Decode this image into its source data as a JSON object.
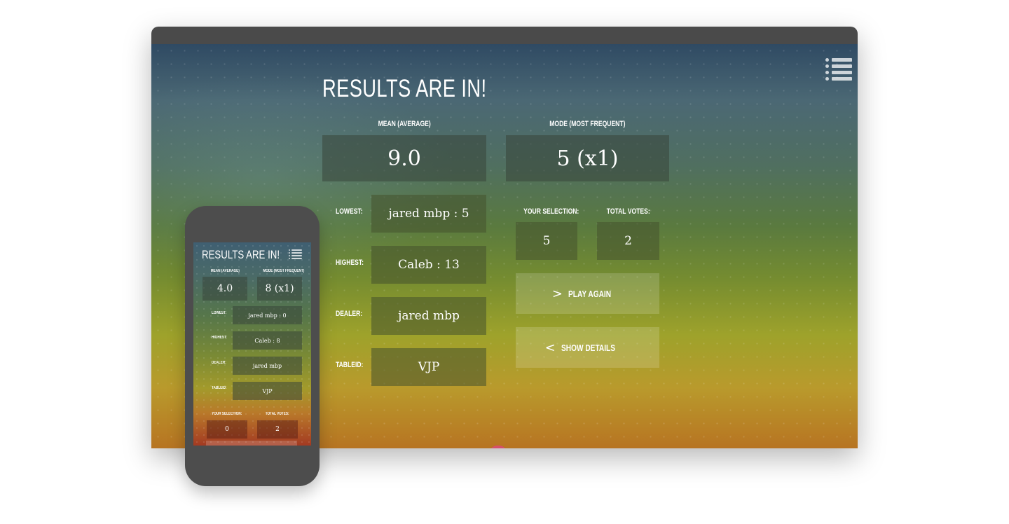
{
  "desktop": {
    "title": "RESULTS ARE IN!",
    "mean_label": "MEAN (AVERAGE)",
    "mean_value": "9.0",
    "mode_label": "MODE (MOST FREQUENT)",
    "mode_value": "5 (x1)",
    "lowest_label": "LOWEST:",
    "lowest_value": "jared mbp : 5",
    "highest_label": "HIGHEST:",
    "highest_value": "Caleb : 13",
    "dealer_label": "DEALER:",
    "dealer_value": "jared mbp",
    "tableid_label": "TABLEID:",
    "tableid_value": "VJP",
    "selection_label": "YOUR SELECTION:",
    "selection_value": "5",
    "votes_label": "TOTAL VOTES:",
    "votes_value": "2",
    "play_again_label": "PLAY AGAIN",
    "play_again_icon": ">",
    "show_details_label": "SHOW DETAILS",
    "show_details_icon": "<"
  },
  "phone": {
    "title": "RESULTS ARE IN!",
    "mean_label": "MEAN (AVERAGE)",
    "mean_value": "4.0",
    "mode_label": "MODE (MOST FREQUENT)",
    "mode_value": "8 (x1)",
    "lowest_label": "LOWEST:",
    "lowest_value": "jared mbp : 0",
    "highest_label": "HIGHEST:",
    "highest_value": "Caleb : 8",
    "dealer_label": "DEALER:",
    "dealer_value": "jared mbp",
    "tableid_label": "TABLEID:",
    "tableid_value": "VJP",
    "selection_label": "YOUR SELECTION:",
    "selection_value": "0",
    "votes_label": "TOTAL VOTES:",
    "votes_value": "2"
  },
  "icons": {
    "menu": "menu-list-icon",
    "play": "chevron-right-icon",
    "details": "chevron-left-icon"
  }
}
